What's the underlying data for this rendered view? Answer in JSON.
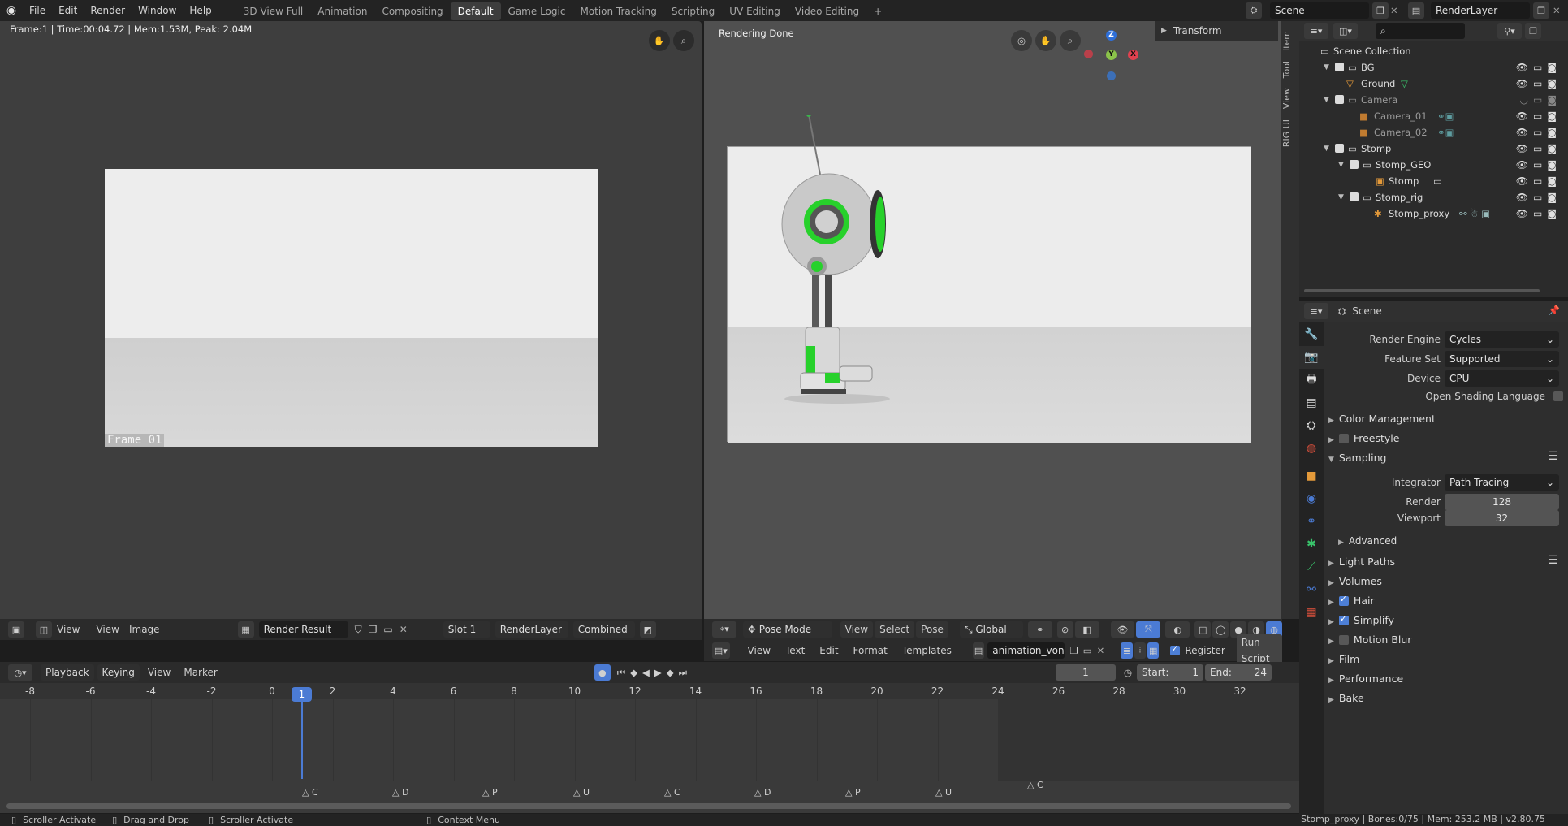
{
  "topbar": {
    "menus": [
      "File",
      "Edit",
      "Render",
      "Window",
      "Help"
    ],
    "workspaces": [
      "3D View Full",
      "Animation",
      "Compositing",
      "Default",
      "Game Logic",
      "Motion Tracking",
      "Scripting",
      "UV Editing",
      "Video Editing"
    ],
    "active_workspace": "Default",
    "add_tab": "+",
    "scene": "Scene",
    "view_layer": "RenderLayer"
  },
  "image_editor": {
    "info": "Frame:1 | Time:00:04.72 | Mem:1.53M, Peak: 2.04M",
    "frame_stamp": "Frame 01",
    "header": {
      "view_menu": "View",
      "view2": "View",
      "image": "Image",
      "image_name": "Render Result",
      "slot": "Slot 1",
      "layer": "RenderLayer",
      "pass": "Combined"
    }
  },
  "viewport": {
    "status": "Rendering Done",
    "transform_panel": "Transform",
    "side_tabs": [
      "Item",
      "Tool",
      "View",
      "RIG UI"
    ],
    "gizmo": {
      "z": "Z",
      "y": "Y",
      "x": "X"
    },
    "header": {
      "mode": "Pose Mode",
      "view": "View",
      "select": "Select",
      "pose": "Pose",
      "orientation": "Global"
    }
  },
  "text_editor": {
    "header": {
      "view": "View",
      "text": "Text",
      "edit": "Edit",
      "format": "Format",
      "templates": "Templates",
      "file": "animation_vonnbot_...",
      "register": "Register",
      "run_script": "Run Script"
    }
  },
  "timeline": {
    "header": {
      "playback": "Playback",
      "keying": "Keying",
      "view": "View",
      "marker": "Marker",
      "current_frame": "1",
      "start_label": "Start:",
      "start": "1",
      "end_label": "End:",
      "end": "24"
    },
    "ticks": [
      "-8",
      "-6",
      "-4",
      "-2",
      "0",
      "2",
      "4",
      "6",
      "8",
      "10",
      "12",
      "14",
      "16",
      "18",
      "20",
      "22",
      "24",
      "26",
      "28",
      "30",
      "32"
    ],
    "current_label": "1",
    "markers": [
      "C",
      "D",
      "P",
      "U",
      "C",
      "D",
      "P",
      "U",
      "C"
    ]
  },
  "status_bar": {
    "item1": "Scroller Activate",
    "item2": "Drag and Drop",
    "item3": "Scroller Activate",
    "item4": "Context Menu",
    "right": "Stomp_proxy | Bones:0/75 | Mem: 253.2 MB | v2.80.75"
  },
  "outliner": {
    "root": "Scene Collection",
    "rows": [
      {
        "name": "BG"
      },
      {
        "name": "Ground"
      },
      {
        "name": "Camera"
      },
      {
        "name": "Camera_01"
      },
      {
        "name": "Camera_02"
      },
      {
        "name": "Stomp"
      },
      {
        "name": "Stomp_GEO"
      },
      {
        "name": "Stomp"
      },
      {
        "name": "Stomp_rig"
      },
      {
        "name": "Stomp_proxy"
      }
    ]
  },
  "properties": {
    "context": "Scene",
    "render_engine_label": "Render Engine",
    "render_engine": "Cycles",
    "feature_set_label": "Feature Set",
    "feature_set": "Supported",
    "device_label": "Device",
    "device": "CPU",
    "osl_label": "Open Shading Language",
    "sections": {
      "color_management": "Color Management",
      "freestyle": "Freestyle",
      "sampling": "Sampling",
      "advanced": "Advanced",
      "light_paths": "Light Paths",
      "volumes": "Volumes",
      "hair": "Hair",
      "simplify": "Simplify",
      "motion_blur": "Motion Blur",
      "film": "Film",
      "performance": "Performance",
      "bake": "Bake"
    },
    "integrator_label": "Integrator",
    "integrator": "Path Tracing",
    "render_label": "Render",
    "render_samples": "128",
    "viewport_label": "Viewport",
    "viewport_samples": "32"
  },
  "colors": {
    "accent": "#4b7bd4",
    "active_green": "#27d12b"
  }
}
